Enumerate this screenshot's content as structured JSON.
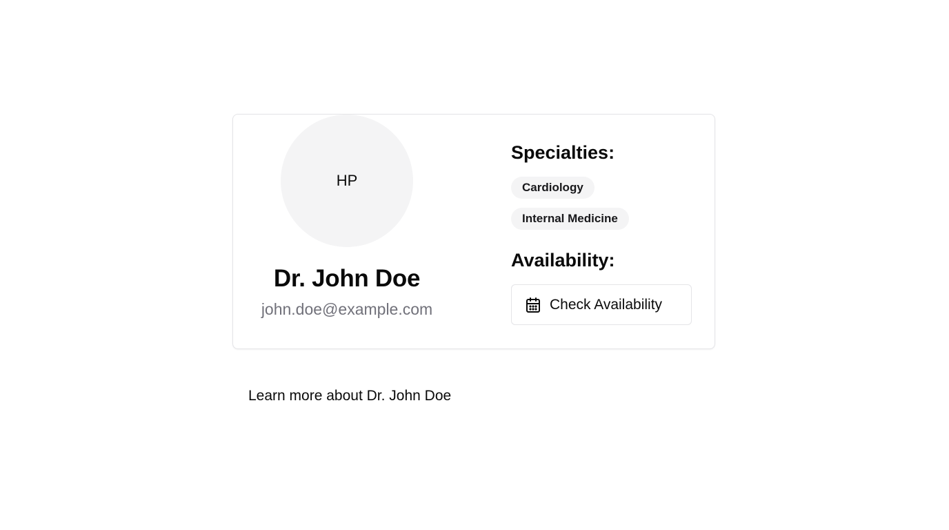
{
  "profile": {
    "avatar_initials": "HP",
    "name": "Dr. John Doe",
    "email": "john.doe@example.com"
  },
  "specialties": {
    "title": "Specialties:",
    "items": [
      "Cardiology",
      "Internal Medicine"
    ]
  },
  "availability": {
    "title": "Availability:",
    "button_label": "Check Availability",
    "button_icon": "calendar-icon"
  },
  "footer": {
    "learn_more_label": "Learn more about Dr. John Doe"
  },
  "colors": {
    "avatar_bg": "#f4f4f5",
    "badge_bg": "#f4f4f5",
    "muted_text": "#71717a",
    "border": "#e4e4e7"
  }
}
